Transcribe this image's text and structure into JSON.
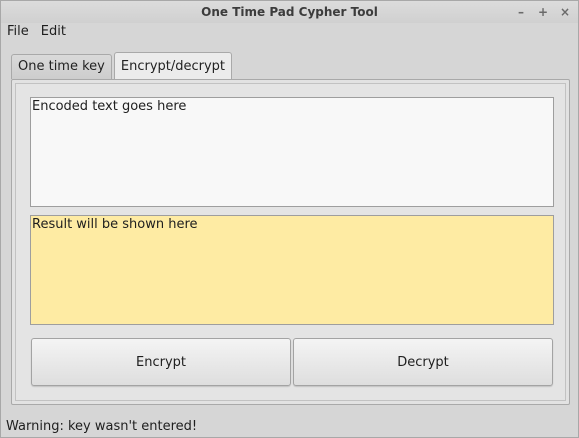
{
  "window": {
    "title": "One Time Pad Cypher Tool",
    "controls": {
      "minimize": "–",
      "maximize": "+",
      "close": "×"
    }
  },
  "menubar": {
    "items": [
      {
        "label": "File"
      },
      {
        "label": "Edit"
      }
    ]
  },
  "tabs": [
    {
      "label": "One time key",
      "active": false
    },
    {
      "label": "Encrypt/decrypt",
      "active": true
    }
  ],
  "encrypt_panel": {
    "input_text": "Encoded text goes here",
    "result_text": "Result will be shown here",
    "encrypt_label": "Encrypt",
    "decrypt_label": "Decrypt"
  },
  "status": {
    "message": "Warning: key wasn't entered!"
  },
  "colors": {
    "result_background": "#feeba3",
    "window_background": "#d6d6d6"
  }
}
